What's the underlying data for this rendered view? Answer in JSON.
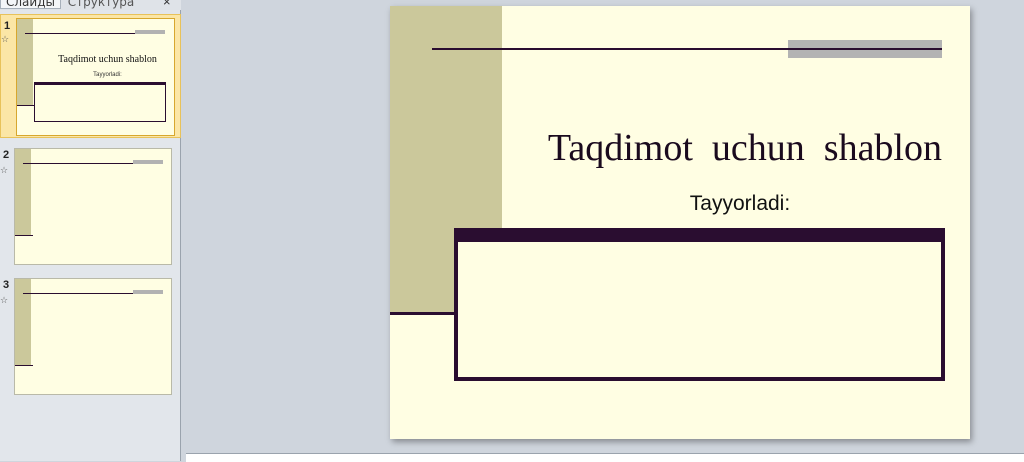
{
  "panel": {
    "tabs": [
      "Слайды",
      "Структура"
    ],
    "close_glyph": "×"
  },
  "thumbnails": [
    {
      "number": "1",
      "title": "Taqdimot  uchun shablon",
      "subtitle": "Tayyorladi:",
      "selected": true
    },
    {
      "number": "2",
      "selected": false
    },
    {
      "number": "3",
      "selected": false
    }
  ],
  "slide": {
    "title": "Taqdimot  uchun  shablon",
    "subtitle": "Tayyorladi:"
  },
  "colors": {
    "slide_bg": "#fffee3",
    "band": "#cbc89b",
    "dark_plum": "#2a0d30",
    "selection": "#fbe6a6"
  },
  "icons": {
    "animation": "star-icon"
  }
}
